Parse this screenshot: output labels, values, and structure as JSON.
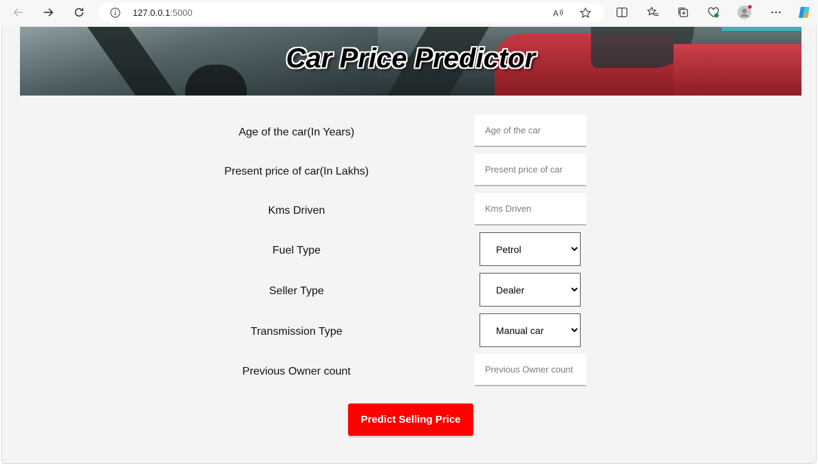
{
  "browser": {
    "url_host": "127.0.0.1",
    "url_port": ":5000",
    "icons": [
      "back-arrow-icon",
      "forward-arrow-icon",
      "refresh-icon",
      "info-icon",
      "read-aloud-icon",
      "favorite-star-icon",
      "split-screen-icon",
      "favorites-icon",
      "collections-icon",
      "browser-essentials-icon",
      "profile-avatar-icon",
      "more-options-icon",
      "copilot-icon"
    ]
  },
  "banner": {
    "title": "Car Price Predictor"
  },
  "form": {
    "age_label": "Age of the car(In Years)",
    "age_placeholder": "Age of the car",
    "price_label": "Present price of car(In Lakhs)",
    "price_placeholder": "Present price of car",
    "kms_label": "Kms Driven",
    "kms_placeholder": "Kms Driven",
    "fuel_label": "Fuel Type",
    "fuel_value": "Petrol",
    "seller_label": "Seller Type",
    "seller_value": "Dealer",
    "transmission_label": "Transmission Type",
    "transmission_value": "Manual car",
    "owner_label": "Previous Owner count",
    "owner_placeholder": "Previous Owner count",
    "submit_label": "Predict Selling Price"
  },
  "colors": {
    "button": "#ff0000",
    "page_bg": "#f4f4f4"
  }
}
